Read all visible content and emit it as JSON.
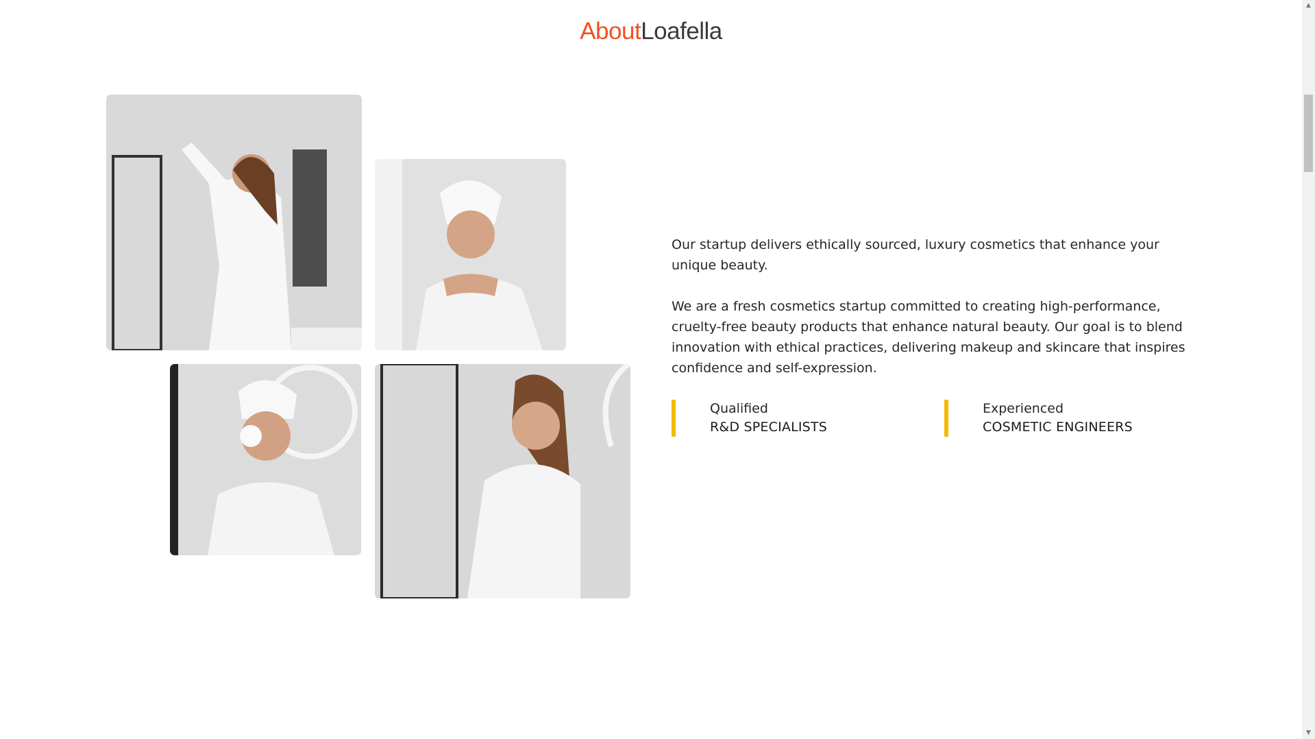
{
  "heading": {
    "accent": "About",
    "brand": "Loafella"
  },
  "photos": [
    {
      "icon": "woman-bathrobe-dancing-photo"
    },
    {
      "icon": "woman-towel-turban-photo"
    },
    {
      "icon": "woman-cotton-pad-photo"
    },
    {
      "icon": "woman-bathrobe-smiling-photo"
    }
  ],
  "about": {
    "intro": "Our startup delivers ethically sourced, luxury cosmetics that enhance your unique beauty.",
    "body": "We are a fresh cosmetics startup committed to creating high-performance, cruelty-free beauty products that enhance natural beauty. Our goal is to blend innovation with ethical practices, delivering makeup and skincare that inspires confidence and self-expression."
  },
  "stats": [
    {
      "small": "Qualified",
      "big": "R&D SPECIALISTS"
    },
    {
      "small": "Experienced",
      "big": "COSMETIC ENGINEERS"
    }
  ],
  "colors": {
    "accent": "#f0511f",
    "bar": "#f5b900"
  }
}
